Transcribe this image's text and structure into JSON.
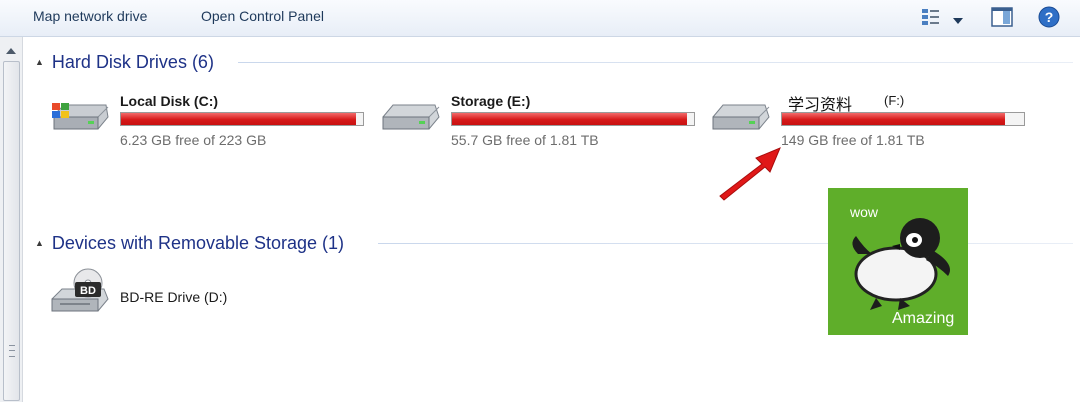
{
  "toolbar": {
    "map_network_drive": "Map network drive",
    "open_control_panel": "Open Control Panel",
    "icons": [
      "view-options-icon",
      "view-dropdown-icon",
      "preview-pane-icon",
      "help-icon"
    ]
  },
  "groups": {
    "hard_disk": {
      "title": "Hard Disk Drives (6)",
      "drives": [
        {
          "name": "Local Disk (C:)",
          "free_text": "6.23 GB free of 223 GB",
          "used_fraction": 0.97,
          "icon": "windows-hard-drive-icon"
        },
        {
          "name": "Storage (E:)",
          "free_text": "55.7 GB free of 1.81 TB",
          "used_fraction": 0.97,
          "icon": "hard-drive-icon"
        },
        {
          "name": "学习资料",
          "letter": "(F:)",
          "free_text": "149 GB free of 1.81 TB",
          "used_fraction": 0.92,
          "icon": "hard-drive-icon"
        }
      ]
    },
    "removable": {
      "title": "Devices with Removable Storage (1)",
      "drives": [
        {
          "name": "BD-RE Drive (D:)",
          "icon": "bd-drive-icon",
          "badge": "BD"
        }
      ]
    }
  },
  "sticker": {
    "top_text": "wow",
    "bottom_text": "Amazing",
    "background": "#5fae2a"
  },
  "colors": {
    "bar_fill": "#d61a1a",
    "group_title": "#1e3287",
    "arrow": "#e01818"
  }
}
